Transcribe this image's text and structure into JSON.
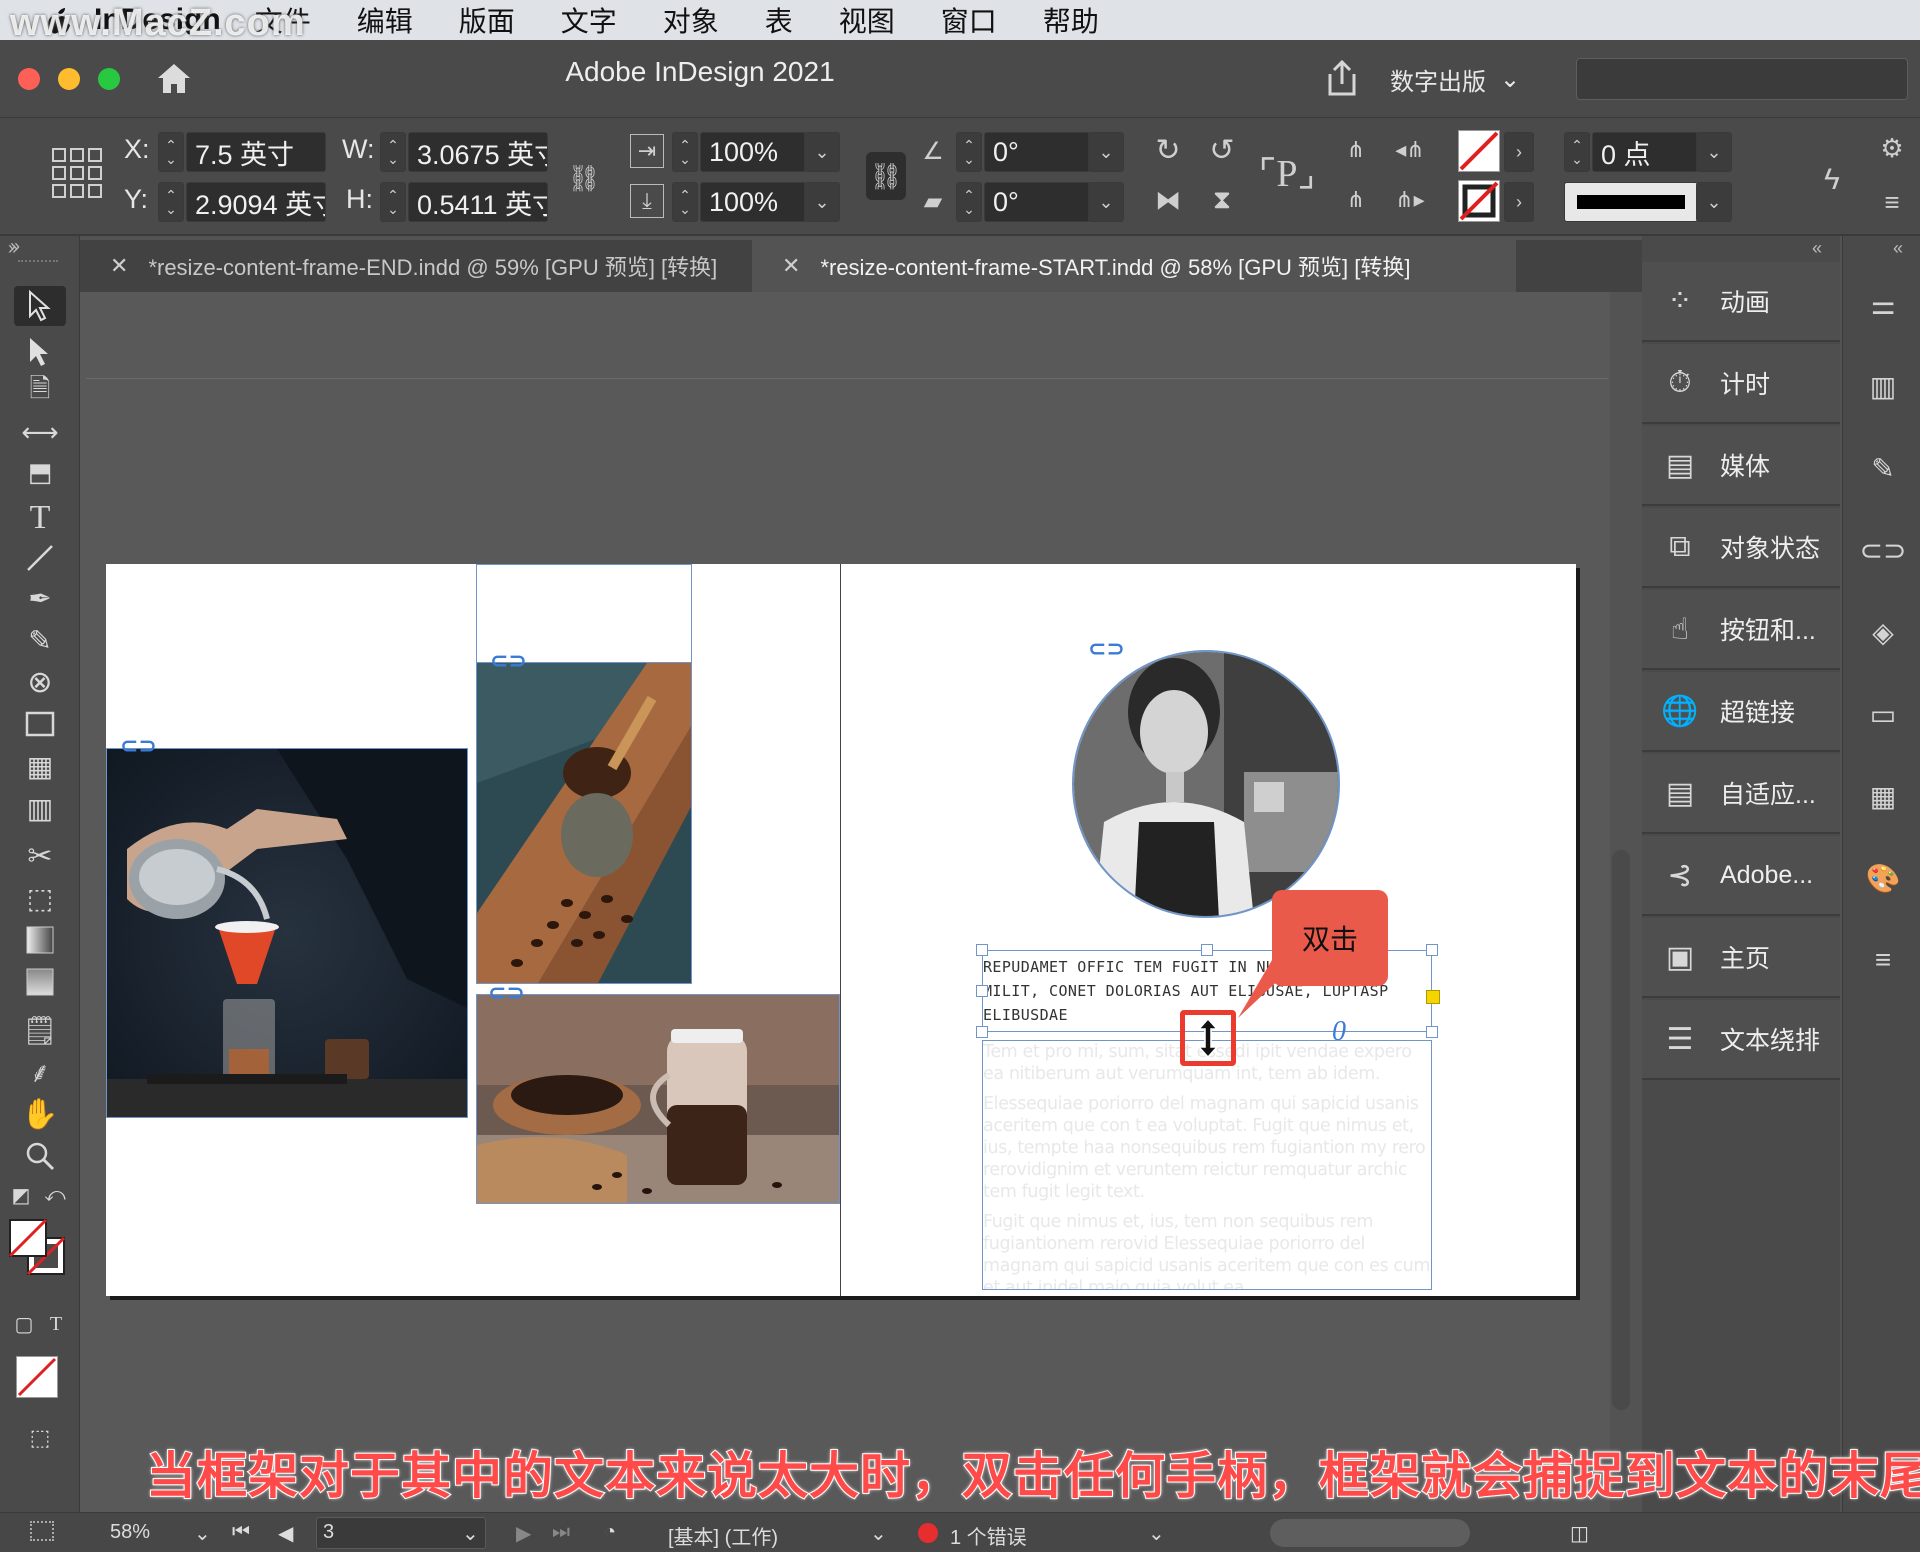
{
  "menubar": {
    "watermark": "www.MacZ.com",
    "app_name": "InDesign",
    "items": [
      "文件",
      "编辑",
      "版面",
      "文字",
      "对象",
      "表",
      "视图",
      "窗口",
      "帮助"
    ]
  },
  "window": {
    "title": "Adobe InDesign 2021",
    "workspace": "数字出版"
  },
  "control": {
    "x_label": "X:",
    "x_value": "7.5 英寸",
    "y_label": "Y:",
    "y_value": "2.9094 英寸",
    "w_label": "W:",
    "w_value": "3.0675 英寸",
    "h_label": "H:",
    "h_value": "0.5411 英寸",
    "scale_x": "100%",
    "scale_y": "100%",
    "rotate": "0°",
    "shear": "0°",
    "stroke_weight": "0 点"
  },
  "tabs": [
    {
      "label": "*resize-content-frame-END.indd @ 59% [GPU 预览] [转换]",
      "active": false
    },
    {
      "label": "*resize-content-frame-START.indd @ 58% [GPU 预览] [转换]",
      "active": true
    }
  ],
  "document": {
    "heading_text": "REPUDAMET OFFIC TEM FUGIT IN NULLAM, T ET MILIT, CONET DOLORIAS AUT ELIBUSAE, LUPTASP ELIBUSDAE",
    "body": [
      "Tem et pro mi, sum, sitat essedi ipit vendae expero ea nitiberum aut verumquam int, tem ab idem.",
      "Elessequiae poriorro del magnam qui sapicid usanis aceritem que con t ea voluptat. Fugit que nimus et, ius, tempte haa nonsequibus rem fugiantion my rero rerovidignim et veruntem reictur remquatur archic tem fugit legit text.",
      "Fugit que nimus et, ius, tem non sequibus rem fugiantionem rerovid Elessequiae poriorro del magnam qui sapicid usanis aceritem que con es cum et aut ipidel maio quia volut ea."
    ]
  },
  "callout": {
    "label": "双击"
  },
  "panels": [
    "动画",
    "计时",
    "媒体",
    "对象状态",
    "按钮和...",
    "超链接",
    "自适应...",
    "Adobe...",
    "主页",
    "文本绕排"
  ],
  "status": {
    "zoom": "58%",
    "page": "3",
    "profile": "[基本] (工作)",
    "errors": "1 个错误"
  },
  "caption": "当框架对于其中的文本来说太大时，双击任何手柄，框架就会捕捉到文本的末尾",
  "colors": {
    "error_dot": "#e62e2e",
    "callout": "#ea5a4b",
    "caption": "#ff4a4a",
    "frame": "#6f95c9"
  }
}
